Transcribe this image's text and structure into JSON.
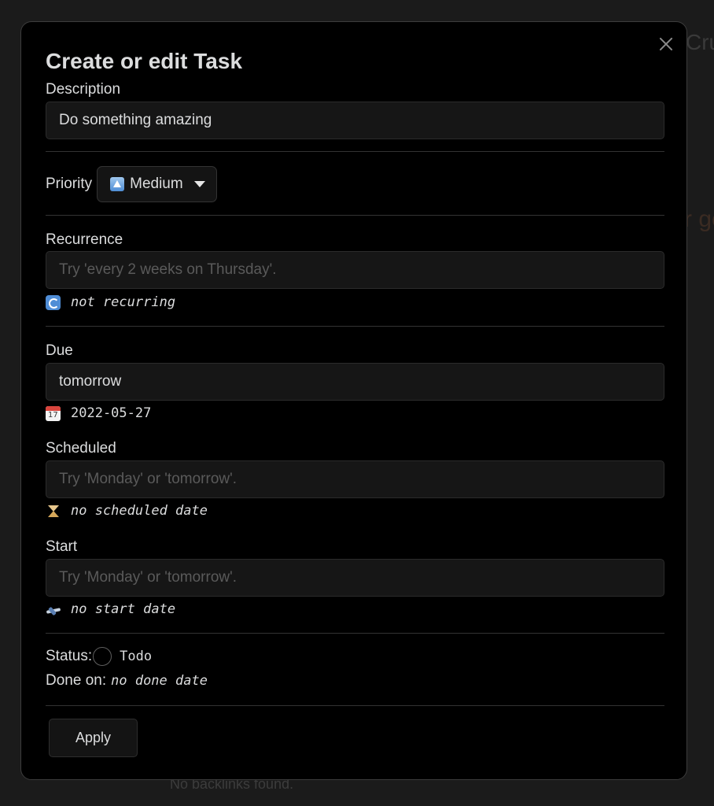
{
  "background": {
    "title_fragment": "Cru",
    "side_fragment": "r ge",
    "backlinks_text": "No backlinks found."
  },
  "modal": {
    "title": "Create or edit Task",
    "close_icon": "close-icon"
  },
  "description": {
    "label": "Description",
    "value": "Do something amazing"
  },
  "priority": {
    "label": "Priority",
    "selected": "Medium",
    "selected_icon": "up-arrow-emoji"
  },
  "recurrence": {
    "label": "Recurrence",
    "value": "",
    "placeholder": "Try 'every 2 weeks on Thursday'.",
    "info_icon": "repeat-icon",
    "info": "not recurring"
  },
  "due": {
    "label": "Due",
    "value": "tomorrow",
    "info_icon": "calendar-icon",
    "info": "2022-05-27"
  },
  "scheduled": {
    "label": "Scheduled",
    "value": "",
    "placeholder": "Try 'Monday' or 'tomorrow'.",
    "info_icon": "hourglass-icon",
    "info": "no scheduled date"
  },
  "start": {
    "label": "Start",
    "value": "",
    "placeholder": "Try 'Monday' or 'tomorrow'.",
    "info_icon": "airplane-departure-icon",
    "info": "no start date"
  },
  "status": {
    "label": "Status:",
    "value": "Todo"
  },
  "done": {
    "label": "Done on:",
    "value": "no done date"
  },
  "apply_label": "Apply",
  "colors": {
    "modal_bg": "#000000",
    "page_bg": "#1b1b1b",
    "text": "#dcddde",
    "input_bg": "#161616"
  }
}
